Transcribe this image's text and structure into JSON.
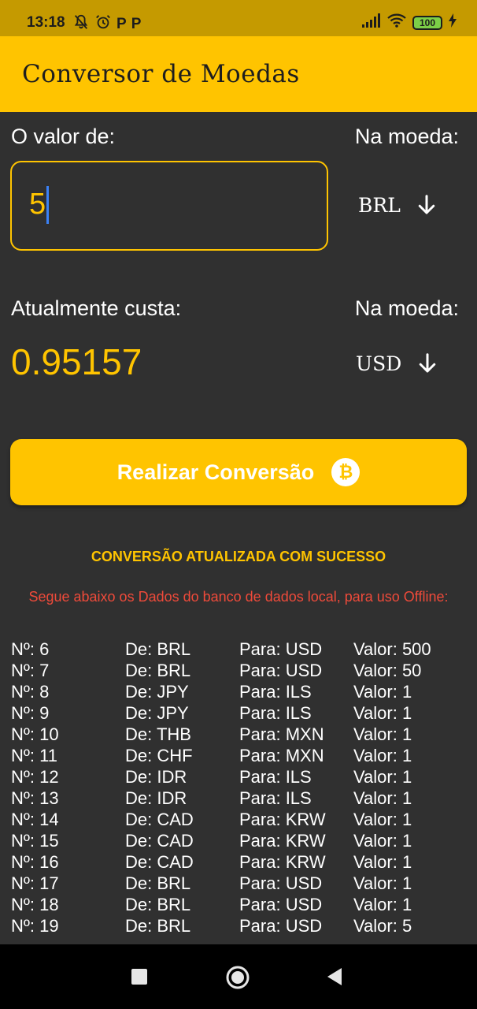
{
  "status_bar": {
    "time": "13:18",
    "battery": "100",
    "p1": "P",
    "p2": "P"
  },
  "app": {
    "title": "Conversor de Moedas"
  },
  "form": {
    "value_label": "O valor de:",
    "currency_label_from": "Na moeda:",
    "input_value": "5",
    "from_currency": "BRL",
    "result_label": "Atualmente custa:",
    "currency_label_to": "Na moeda:",
    "result_value": "0.95157",
    "to_currency": "USD"
  },
  "convert_button": {
    "label": "Realizar Conversão",
    "icon": "bitcoin-icon"
  },
  "messages": {
    "success": "CONVERSÃO ATUALIZADA COM SUCESSO",
    "offline_info": "Segue abaixo os Dados do banco de dados local, para uso Offline:"
  },
  "records": [
    {
      "id": "Nº: 6",
      "from": "De: BRL",
      "to": "Para: USD",
      "value": "Valor: 500"
    },
    {
      "id": "Nº: 7",
      "from": "De: BRL",
      "to": "Para: USD",
      "value": "Valor: 50"
    },
    {
      "id": "Nº: 8",
      "from": "De: JPY",
      "to": "Para: ILS",
      "value": "Valor: 1"
    },
    {
      "id": "Nº: 9",
      "from": "De: JPY",
      "to": "Para: ILS",
      "value": "Valor: 1"
    },
    {
      "id": "Nº: 10",
      "from": "De: THB",
      "to": "Para: MXN",
      "value": "Valor: 1"
    },
    {
      "id": "Nº: 11",
      "from": "De: CHF",
      "to": "Para: MXN",
      "value": "Valor: 1"
    },
    {
      "id": "Nº: 12",
      "from": "De: IDR",
      "to": "Para: ILS",
      "value": "Valor: 1"
    },
    {
      "id": "Nº: 13",
      "from": "De: IDR",
      "to": "Para: ILS",
      "value": "Valor: 1"
    },
    {
      "id": "Nº: 14",
      "from": "De: CAD",
      "to": "Para: KRW",
      "value": "Valor: 1"
    },
    {
      "id": "Nº: 15",
      "from": "De: CAD",
      "to": "Para: KRW",
      "value": "Valor: 1"
    },
    {
      "id": "Nº: 16",
      "from": "De: CAD",
      "to": "Para: KRW",
      "value": "Valor: 1"
    },
    {
      "id": "Nº: 17",
      "from": "De: BRL",
      "to": "Para: USD",
      "value": "Valor: 1"
    },
    {
      "id": "Nº: 18",
      "from": "De: BRL",
      "to": "Para: USD",
      "value": "Valor: 1"
    },
    {
      "id": "Nº: 19",
      "from": "De: BRL",
      "to": "Para: USD",
      "value": "Valor: 5"
    }
  ],
  "colors": {
    "accent": "#ffc400",
    "status_bar": "#c59a00",
    "background": "#303030",
    "info_text": "#ef4a3a"
  },
  "nav_bar": {
    "icons": [
      "square-recent-apps-icon",
      "circle-home-icon",
      "triangle-back-icon"
    ]
  }
}
